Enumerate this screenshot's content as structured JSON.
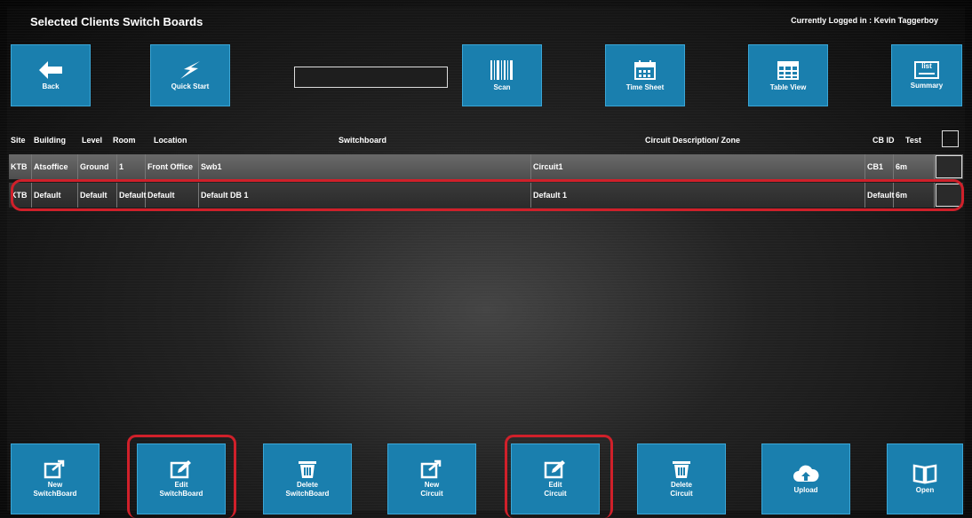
{
  "header": {
    "title": "Selected Clients Switch Boards",
    "login_prefix": "Currently Logged in : ",
    "user": "Kevin Taggerboy"
  },
  "toolbar": {
    "back": "Back",
    "quick_start": "Quick Start",
    "search_value": "",
    "scan": "Scan",
    "time_sheet": "Time Sheet",
    "table_view": "Table View",
    "summary": "Summary",
    "summary_icon_text": "list"
  },
  "table": {
    "columns": [
      "Site",
      "Building",
      "Level",
      "Room",
      "Location",
      "Switchboard",
      "Circuit Description/ Zone",
      "CB ID",
      "Test"
    ],
    "rows": [
      [
        "KTB",
        "Atsoffice",
        "Ground",
        "1",
        "Front Office",
        "Swb1",
        "Circuit1",
        "CB1",
        "6m"
      ],
      [
        "KTB",
        "Default",
        "Default",
        "Default",
        "Default",
        "Default DB 1",
        "Default 1",
        "Default",
        "6m"
      ]
    ]
  },
  "bottom_bar": {
    "new_switchboard": [
      "New",
      "SwitchBoard"
    ],
    "edit_switchboard": [
      "Edit",
      "SwitchBoard"
    ],
    "delete_switchboard": [
      "Delete",
      "SwitchBoard"
    ],
    "new_circuit": [
      "New",
      "Circuit"
    ],
    "edit_circuit": [
      "Edit",
      "Circuit"
    ],
    "delete_circuit": [
      "Delete",
      "Circuit"
    ],
    "upload": "Upload",
    "open": "Open"
  },
  "colors": {
    "button": "#1a7fae",
    "highlight": "#d0202a",
    "background": "#1c1c1c"
  }
}
